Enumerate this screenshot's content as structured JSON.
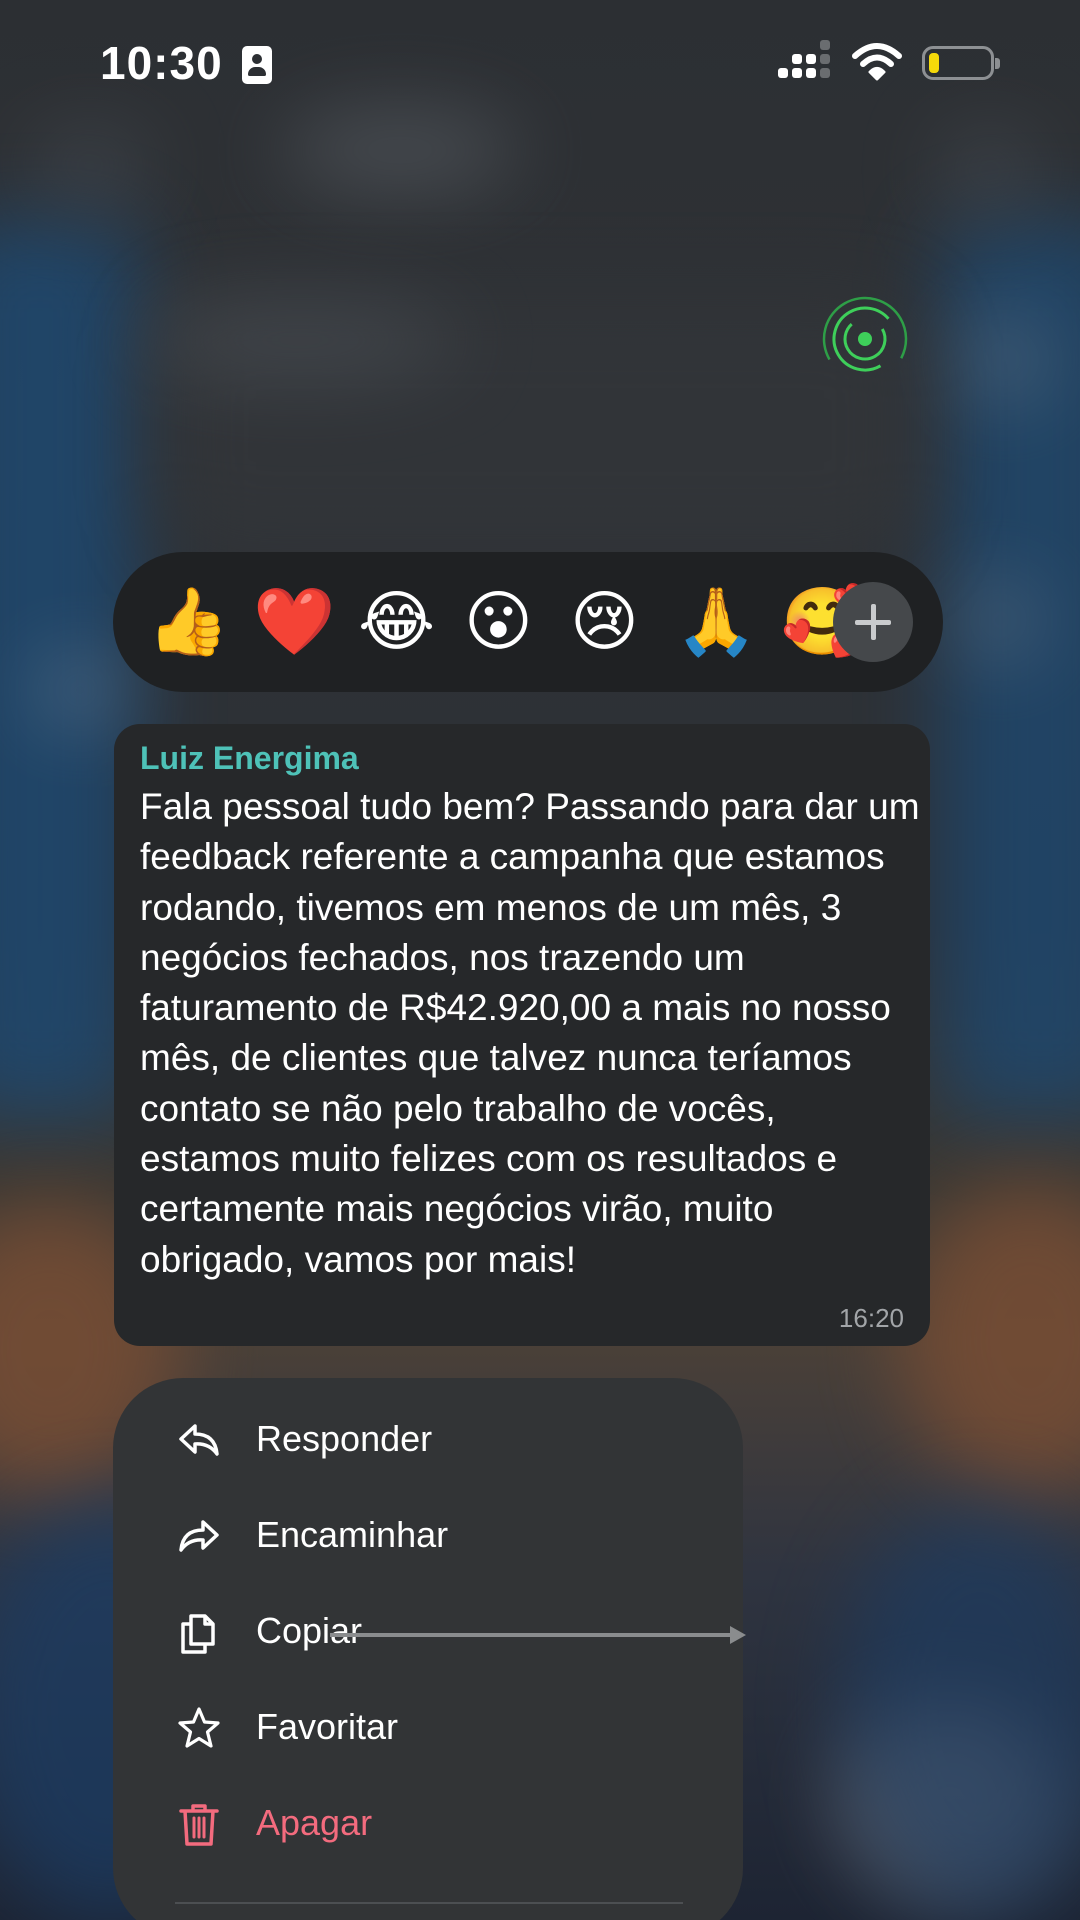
{
  "status_bar": {
    "time": "10:30"
  },
  "reactions": [
    {
      "emoji": "👍",
      "name": "thumbs-up"
    },
    {
      "emoji": "❤️",
      "name": "red-heart"
    },
    {
      "emoji": "😂",
      "name": "tears-of-joy"
    },
    {
      "emoji": "😮",
      "name": "open-mouth"
    },
    {
      "emoji": "😢",
      "name": "crying-face"
    },
    {
      "emoji": "🙏",
      "name": "folded-hands"
    },
    {
      "emoji": "🥰",
      "name": "smiling-face-with-hearts"
    }
  ],
  "message": {
    "sender": "Luiz Energima",
    "text": "Fala pessoal tudo bem? Passando para dar um feedback referente a campanha que estamos rodando, tivemos em menos de um mês, 3 negócios fechados, nos trazendo um faturamento de R$42.920,00 a mais no nosso mês, de clientes que talvez nunca teríamos contato se não pelo trabalho de vocês, estamos muito felizes com os resultados e certamente mais negócios virão, muito obrigado, vamos por mais!",
    "time": "16:20"
  },
  "menu": {
    "items": [
      {
        "label": "Responder",
        "icon": "reply-icon"
      },
      {
        "label": "Encaminhar",
        "icon": "forward-icon"
      },
      {
        "label": "Copiar",
        "icon": "copy-icon"
      },
      {
        "label": "Favoritar",
        "icon": "star-icon"
      },
      {
        "label": "Apagar",
        "icon": "trash-icon"
      }
    ]
  },
  "colors": {
    "sender": "#4ec2b8",
    "danger": "#f36b7e",
    "bubble": "#26282a",
    "menu": "#323436",
    "live_indicator": "#3ecf5a",
    "battery": "#f5d90a"
  }
}
